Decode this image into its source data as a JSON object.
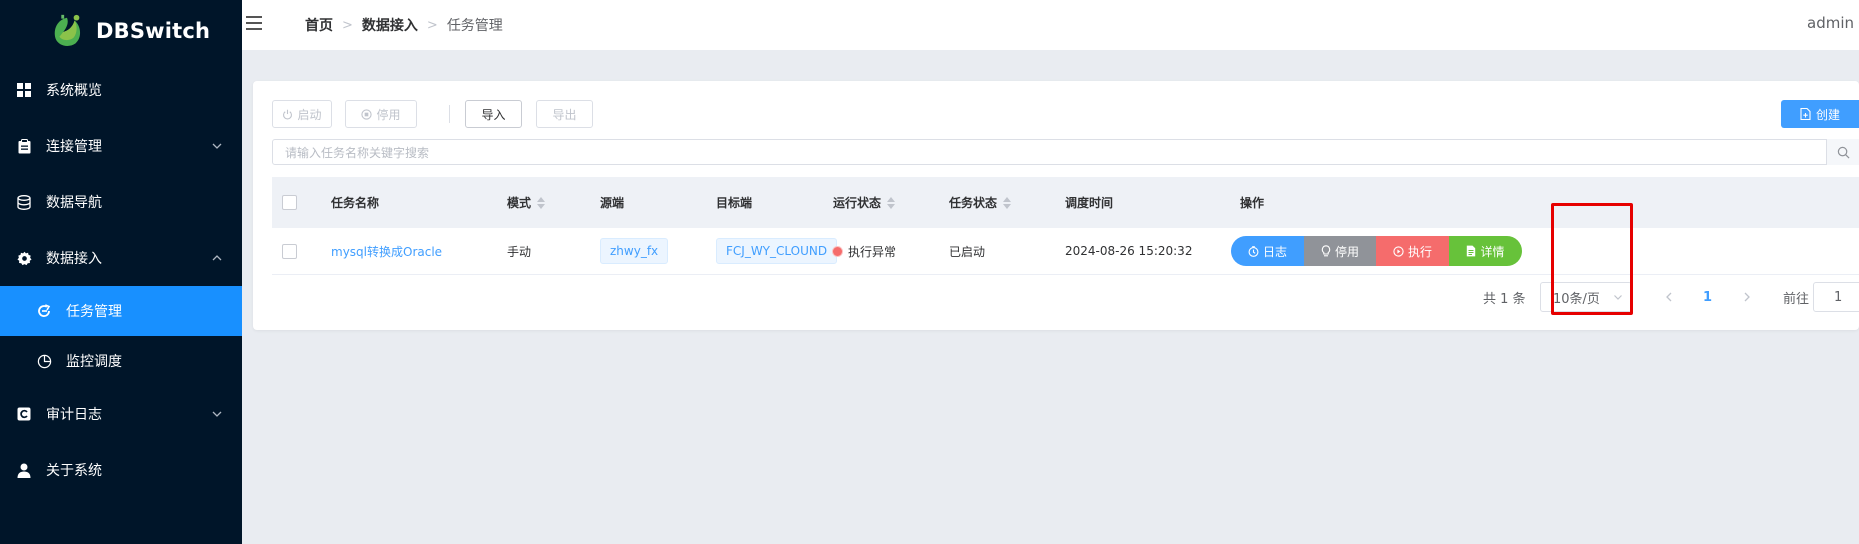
{
  "app": {
    "title": "DBSwitch",
    "user": "admin"
  },
  "sidebar": {
    "items": [
      {
        "label": "系统概览",
        "icon": "dashboard-icon"
      },
      {
        "label": "连接管理",
        "icon": "clipboard-icon"
      },
      {
        "label": "数据导航",
        "icon": "database-icon"
      },
      {
        "label": "数据接入",
        "icon": "gear-icon"
      },
      {
        "label": "任务管理",
        "icon": "refresh-icon"
      },
      {
        "label": "监控调度",
        "icon": "pie-chart-icon"
      },
      {
        "label": "审计日志",
        "icon": "audit-icon"
      },
      {
        "label": "关于系统",
        "icon": "user-icon"
      }
    ],
    "active": "任务管理"
  },
  "breadcrumb": [
    "首页",
    "数据接入",
    "任务管理"
  ],
  "toolbar": {
    "start_label": "启动",
    "stop_label": "停用",
    "import_label": "导入",
    "export_label": "导出",
    "create_label": "创建"
  },
  "search": {
    "placeholder": "请输入任务名称关键字搜索",
    "value": ""
  },
  "table": {
    "columns": [
      "任务名称",
      "模式",
      "源端",
      "目标端",
      "运行状态",
      "任务状态",
      "调度时间",
      "操作"
    ],
    "rows": [
      {
        "name": "mysql转换成Oracle",
        "mode": "手动",
        "source": "zhwy_fx",
        "target": "FCJ_WY_CLOUND",
        "run_status": "执行异常",
        "task_status": "已启动",
        "schedule_time": "2024-08-26 15:20:32",
        "ops": {
          "log": "日志",
          "stop": "停用",
          "run": "执行",
          "detail": "详情"
        }
      }
    ]
  },
  "pagination": {
    "total": "共 1 条",
    "page_size": "10条/页",
    "current_page": "1",
    "goto_label": "前往",
    "goto_value": "1"
  },
  "colors": {
    "sidebar_bg": "#001529",
    "active_menu": "#1890ff",
    "primary": "#409eff",
    "danger": "#f56c6c",
    "success": "#67c23a",
    "info": "#909399",
    "highlight_box": "#e60000"
  }
}
